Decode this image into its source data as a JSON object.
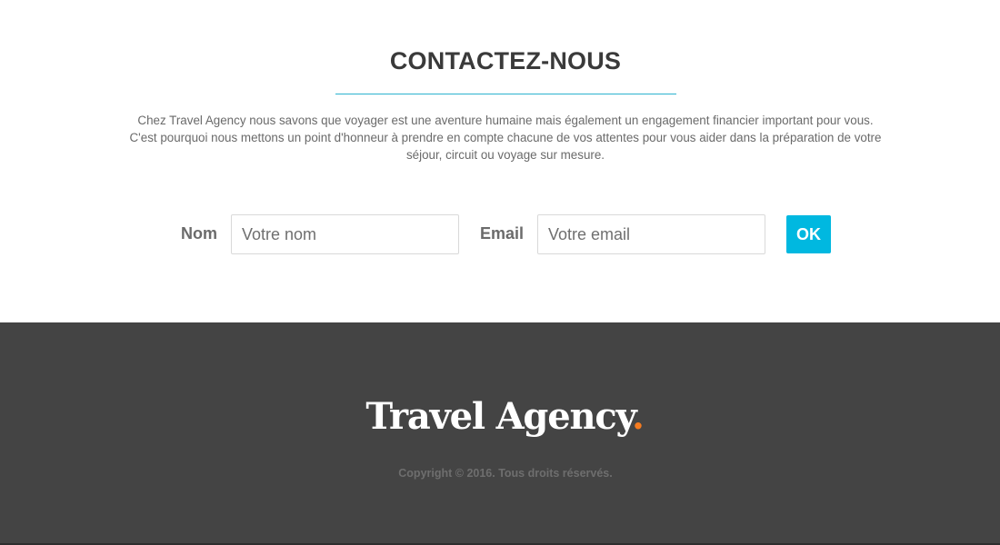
{
  "contact": {
    "title": "CONTACTEZ-NOUS",
    "intro_lines": [
      "Chez Travel Agency nous savons que voyager est une aventure humaine mais également un engagement financier important pour vous.",
      "C'est pourquoi nous mettons un point d'honneur à prendre en compte chacune de vos attentes pour vous aider dans la préparation de votre",
      "séjour, circuit ou voyage sur mesure."
    ],
    "form": {
      "name_label": "Nom",
      "name_placeholder": "Votre nom",
      "name_value": "",
      "email_label": "Email",
      "email_placeholder": "Votre email",
      "email_value": "",
      "submit_label": "OK"
    }
  },
  "footer": {
    "brand_name": "Travel Agency",
    "brand_dot": ".",
    "copyright": "Copyright © 2016. Tous droits réservés."
  },
  "colors": {
    "accent": "#00b8e0",
    "title_rule": "#2bb3cf",
    "brand_dot": "#f47b20",
    "footer_background": "#444444",
    "heading_text": "#3a3a3a"
  }
}
